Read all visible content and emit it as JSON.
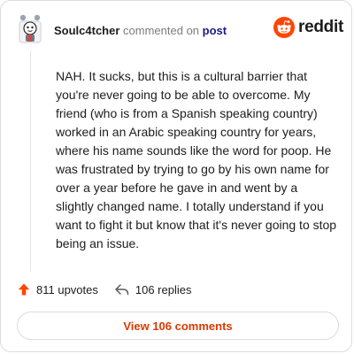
{
  "header": {
    "username": "Soulc4tcher",
    "action_text": "commented on",
    "post_link": "post"
  },
  "brand": {
    "logo_text": "reddit",
    "logo_icon": "reddit-snoo-icon",
    "accent_color": "#ff4500"
  },
  "comment": {
    "body": "NAH. It sucks, but this is a cultural barrier that you're never going to be able to overcome. My friend (who is from a Spanish speaking country) worked in an Arabic speaking country for years, where his name sounds like the word for poop. He was frustrated by trying to go by his own name for over a year before he gave in and went by a slightly changed name. I totally understand if you want to fight it but know that it's never going to stop being an issue."
  },
  "stats": {
    "upvotes": "811 upvotes",
    "upvote_icon": "upvote-arrow-icon",
    "upvote_color": "#ff4500",
    "replies": "106 replies",
    "reply_icon": "reply-arrow-icon"
  },
  "footer": {
    "view_comments_label": "View 106 comments",
    "link_color": "#d93a00"
  }
}
